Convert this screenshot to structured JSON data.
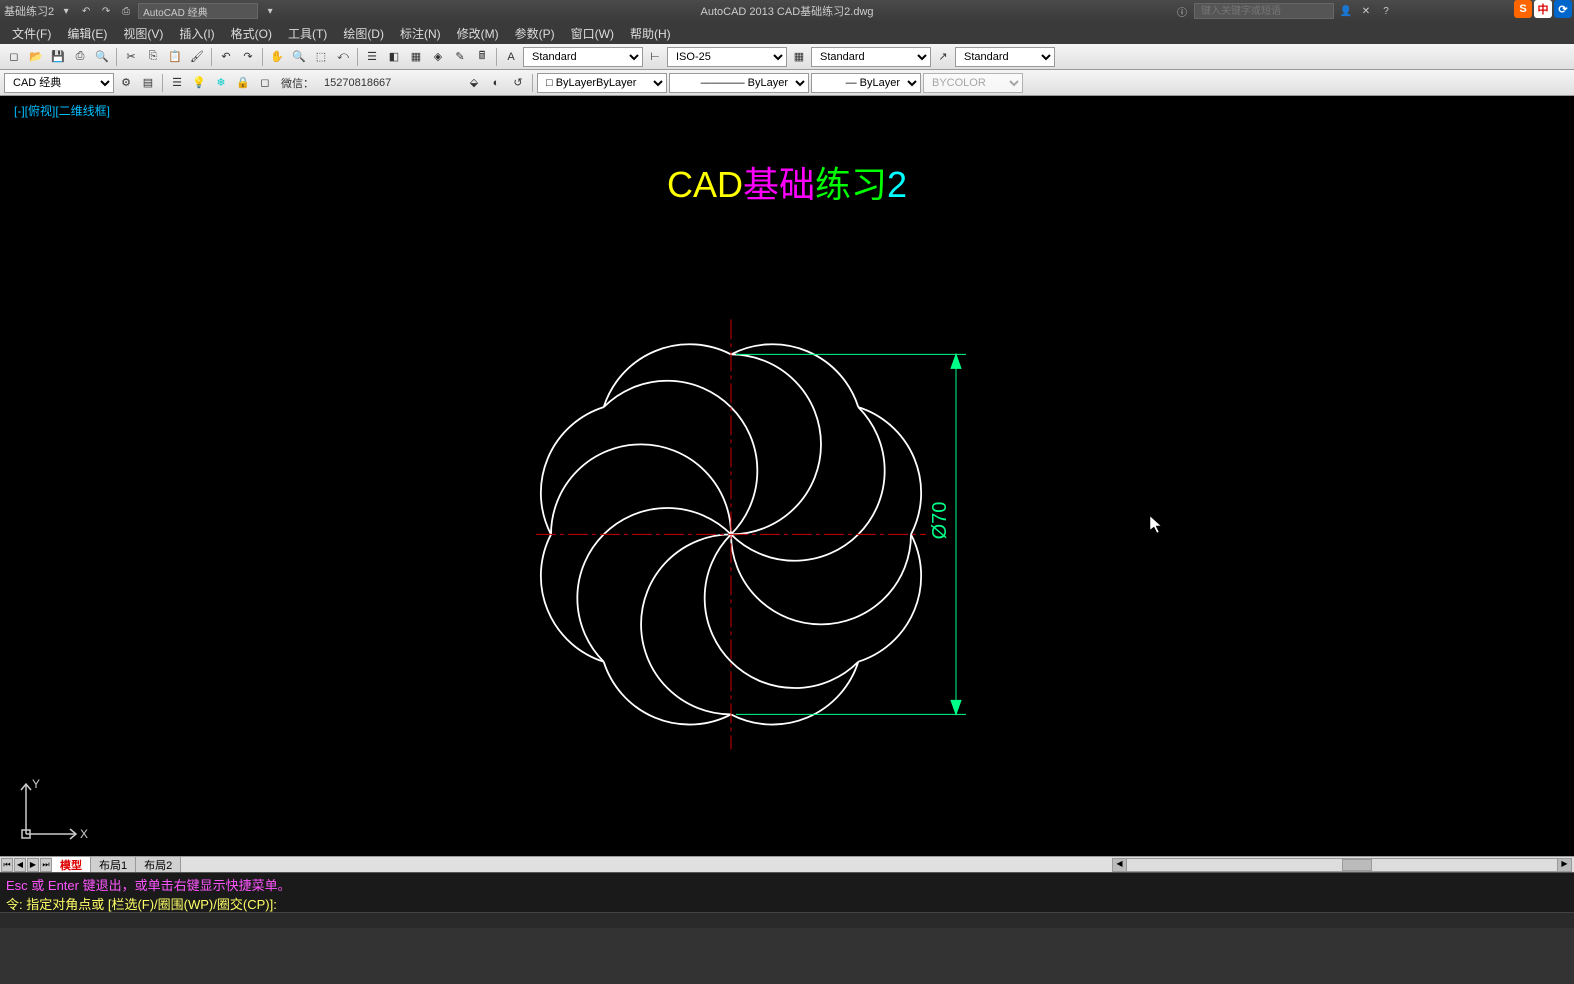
{
  "title_bar": {
    "doc_name": "基础练习2",
    "workspace": "AutoCAD 经典",
    "app_title": "AutoCAD 2013     CAD基础练习2.dwg",
    "search_placeholder": "键入关键字或短语"
  },
  "menu": [
    "文件(F)",
    "编辑(E)",
    "视图(V)",
    "插入(I)",
    "格式(O)",
    "工具(T)",
    "绘图(D)",
    "标注(N)",
    "修改(M)",
    "参数(P)",
    "窗口(W)",
    "帮助(H)"
  ],
  "toolbar1": {
    "text_style": "Standard",
    "dim_style": "ISO-25",
    "table_style": "Standard",
    "mleader_style": "Standard"
  },
  "toolbar2": {
    "workspace": "CAD 经典",
    "wechat_label": "微信：",
    "wechat_value": "15270818667",
    "layer_color": "ByLayer",
    "linetype": "ByLayer",
    "lineweight": "ByLayer",
    "plot_style": "BYCOLOR"
  },
  "viewport": {
    "label": "[-][俯视][二维线框]"
  },
  "drawing": {
    "title_parts": [
      "CAD",
      "基础",
      "练习",
      "2"
    ],
    "dimension": "Ø70",
    "ucs_x": "X",
    "ucs_y": "Y"
  },
  "layout_tabs": {
    "tabs": [
      "模型",
      "布局1",
      "布局2"
    ]
  },
  "command": {
    "line1": "Esc 或 Enter 键退出，或单击右键显示快捷菜单。",
    "line2": "令: 指定对角点或 [栏选(F)/圈围(WP)/圈交(CP)]:"
  }
}
